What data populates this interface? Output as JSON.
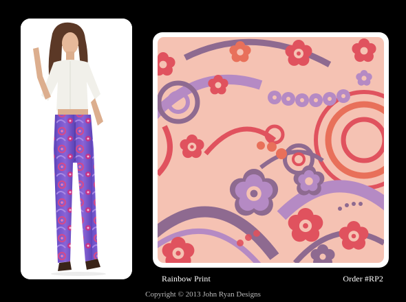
{
  "product": {
    "name": "Rainbow Print",
    "order": "Order #RP2"
  },
  "footer": {
    "copyright": "Copyright © 2013 John Ryan Designs"
  },
  "colors": {
    "background": "#000000",
    "card": "#ffffff",
    "pattern_base": "#f5c2b3",
    "pattern_red": "#e0525e",
    "pattern_coral": "#e8705a",
    "pattern_lilac": "#b58ac4",
    "pattern_purple": "#8e6a90",
    "pattern_pink": "#f28a95"
  },
  "images": {
    "model_photo": "model-wearing-printed-jeans",
    "fabric_swatch": "floral-paisley-print-swatch"
  }
}
